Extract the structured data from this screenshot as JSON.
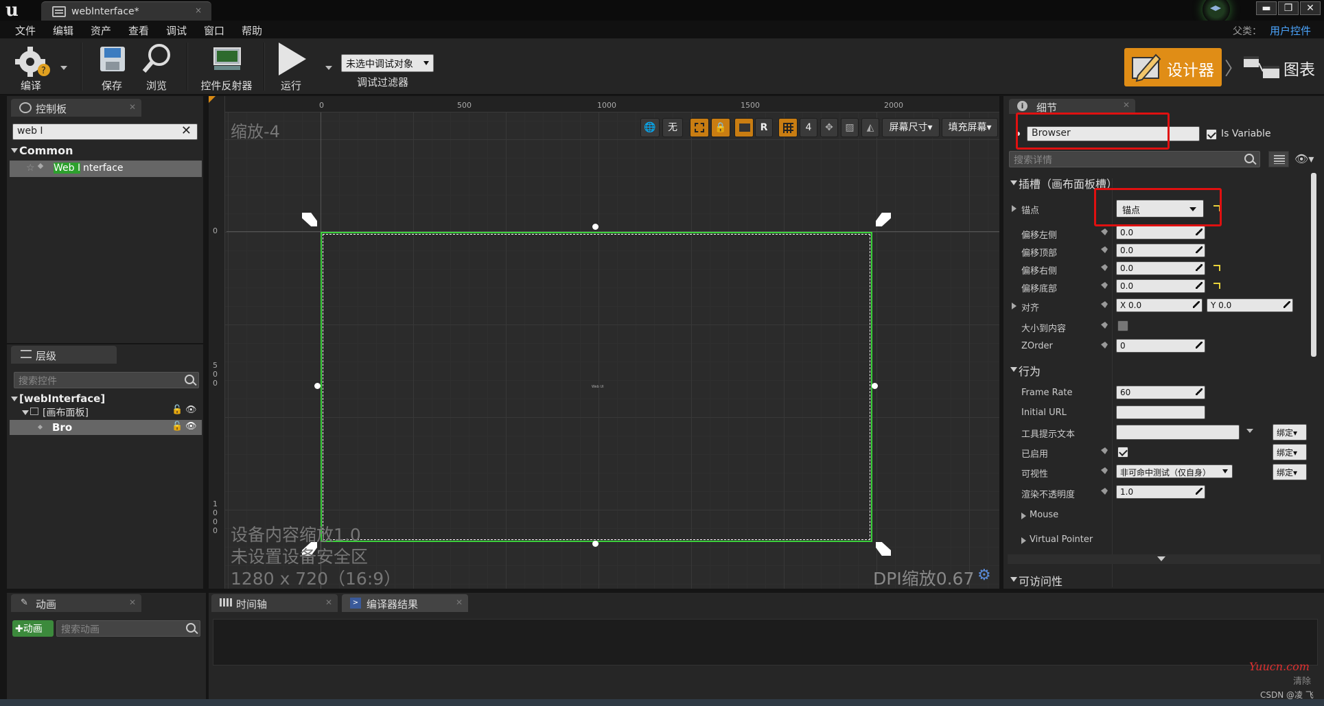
{
  "window": {
    "tab_title": "webInterface*",
    "close": "×",
    "sys_min": "▬",
    "sys_max": "❐",
    "sys_close": "✕"
  },
  "menu": {
    "items": [
      "文件",
      "编辑",
      "资产",
      "查看",
      "调试",
      "窗口",
      "帮助"
    ],
    "parent_label": "父类：",
    "parent_value": "用户控件"
  },
  "toolbar": {
    "compile": "编译",
    "save": "保存",
    "browse": "浏览",
    "reflector": "控件反射器",
    "play": "运行",
    "debug_select": "未选中调试对象",
    "debug_filter": "调试过滤器",
    "designer": "设计器",
    "graph": "图表"
  },
  "palette": {
    "tab": "控制板",
    "search_value": "web I",
    "category": "Common",
    "item": {
      "highlight": "Web I",
      "rest": "nterface"
    }
  },
  "hierarchy": {
    "tab": "层级",
    "search_placeholder": "搜索控件",
    "root": "[webInterface]",
    "canvas_panel": "[画布面板]",
    "child": "Bro"
  },
  "designer": {
    "zoom": "缩放-4",
    "ruler_top": [
      "0",
      "500",
      "1000",
      "1500",
      "2000"
    ],
    "ruler_left": [
      [
        "0"
      ],
      [
        "5",
        "0",
        "0"
      ],
      [
        "1",
        "0",
        "0",
        "0"
      ]
    ],
    "tools": {
      "none": "无",
      "r": "R",
      "grid_size": "4",
      "screen_size": "屏幕尺寸",
      "fill_screen": "填充屏幕"
    },
    "info_line1": "设备内容缩放1.0",
    "info_line2": "未设置设备安全区",
    "info_line3": "1280 x 720（16:9）",
    "dpi": "DPI缩放0.67",
    "center_tag": "Web UI"
  },
  "details": {
    "tab": "细节",
    "name_value": "Browser",
    "is_variable": "Is Variable",
    "search_placeholder": "搜索详情",
    "slot_section": "插槽（画布面板槽）",
    "anchor_label": "锚点",
    "anchor_value": "锚点",
    "offset_left": "偏移左侧",
    "offset_left_val": "0.0",
    "offset_top": "偏移顶部",
    "offset_top_val": "0.0",
    "offset_right": "偏移右侧",
    "offset_right_val": "0.0",
    "offset_bottom": "偏移底部",
    "offset_bottom_val": "0.0",
    "alignment": "对齐",
    "align_x": "X  0.0",
    "align_y": "Y  0.0",
    "size_to_content": "大小到内容",
    "zorder": "ZOrder",
    "zorder_val": "0",
    "behavior_section": "行为",
    "frame_rate": "Frame Rate",
    "frame_rate_val": "60",
    "initial_url": "Initial URL",
    "initial_url_val": "",
    "tooltip": "工具提示文本",
    "bind": "绑定",
    "enabled": "已启用",
    "visibility": "可视性",
    "visibility_val": "非可命中测试（仅自身）",
    "render_opacity": "渲染不透明度",
    "render_opacity_val": "1.0",
    "mouse": "Mouse",
    "virtual_pointer": "Virtual Pointer",
    "accessibility": "可访问性"
  },
  "bottom": {
    "anim_tab": "动画",
    "anim_add": "动画",
    "anim_search_placeholder": "搜索动画",
    "timeline_tab": "时间轴",
    "compiler_tab": "编译器结果",
    "clear": "清除"
  },
  "watermark": {
    "site": "Yuucn.com",
    "author": "CSDN @凌 飞"
  },
  "colors": {
    "accent_orange": "#e08d16",
    "selection_green": "#3bd13b",
    "link_blue": "#4ca6ff",
    "annotation_red": "#e01010"
  }
}
